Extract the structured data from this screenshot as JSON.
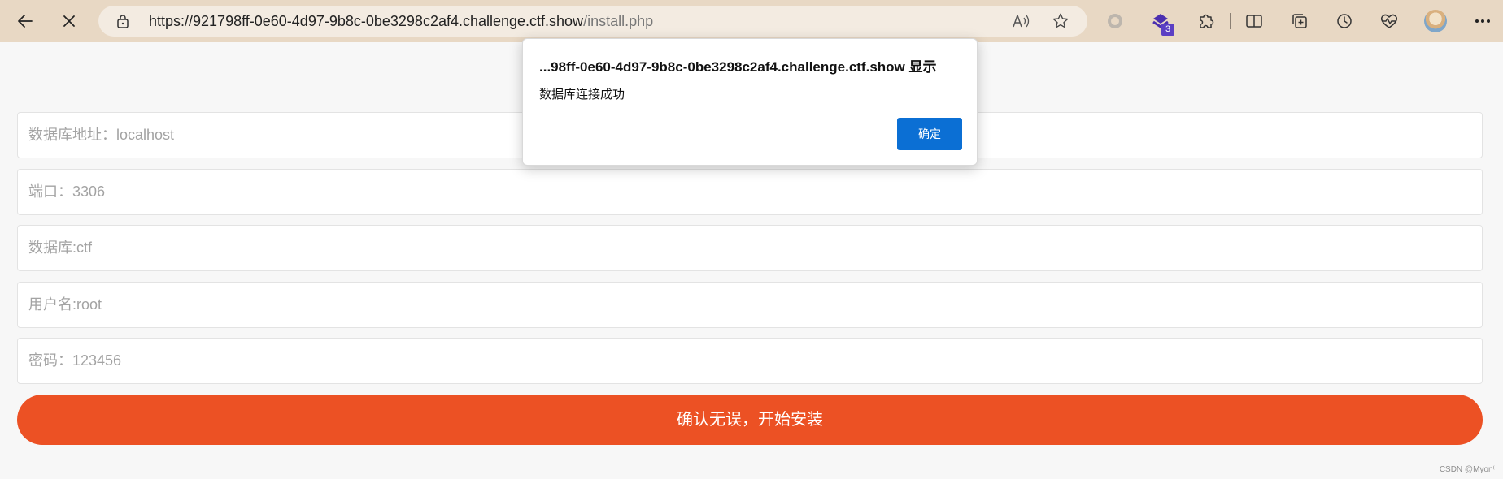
{
  "browser": {
    "url_host": "https://921798ff-0e60-4d97-9b8c-0be3298c2af4.challenge.ctf.show",
    "url_path": "/install.php",
    "extension_badge": "3",
    "icons": {
      "back": "arrow-left-icon",
      "stop": "close-icon",
      "lock": "lock-icon",
      "read_aloud": "read-aloud-icon",
      "favorite": "star-icon",
      "ext1": "circle-extension-icon",
      "ext2": "purple-extension-icon",
      "extensions": "puzzle-icon",
      "split": "split-screen-icon",
      "collections": "collections-icon",
      "history": "history-icon",
      "performance": "heartbeat-icon",
      "profile": "avatar",
      "more": "more-icon"
    }
  },
  "form": {
    "db_host": "数据库地址：localhost",
    "port": "端口：3306",
    "db_name": "数据库:ctf",
    "username": "用户名:root",
    "password": "密码：123456",
    "submit_label": "确认无误，开始安装"
  },
  "dialog": {
    "title": "...98ff-0e60-4d97-9b8c-0be3298c2af4.challenge.ctf.show 显示",
    "message": "数据库连接成功",
    "ok_label": "确定"
  },
  "watermark": "CSDN @Myon⁽",
  "colors": {
    "toolbar": "#e8d8c4",
    "accent_button": "#ec5124",
    "dialog_ok": "#0b6fd4",
    "badge": "#5b3fc4"
  }
}
